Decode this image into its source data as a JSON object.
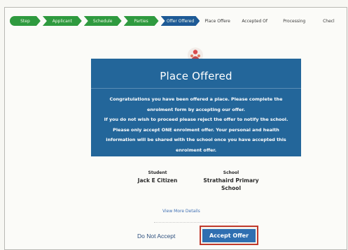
{
  "stepper": {
    "steps": [
      {
        "label": "Step"
      },
      {
        "label": "Applicant"
      },
      {
        "label": "Schedule"
      },
      {
        "label": "Parties"
      },
      {
        "label": "Offer Offered"
      },
      {
        "label": "Place Offere"
      },
      {
        "label": "Accepted Of"
      },
      {
        "label": "Processing"
      },
      {
        "label": "Checl"
      }
    ]
  },
  "panel": {
    "title": "Place Offered",
    "paragraph1": "Congratulations you have been offered a place. Please complete the enrolment form by accepting our offer.",
    "paragraph2": "If you do not wish to proceed please reject the offer to notify the school.",
    "paragraph3": "Please only accept ONE enrolment offer. Your personal and health information will be shared with the school once you have accepted this enrolment offer."
  },
  "details": {
    "student_label": "Student",
    "student_name": "Jack E Citizen",
    "school_label": "School",
    "school_name": "Strathaird Primary School"
  },
  "links": {
    "view_more": "View More Details"
  },
  "actions": {
    "decline_label": "Do Not Accept",
    "accept_label": "Accept Offer"
  },
  "colors": {
    "panel_blue": "#23669a",
    "step_done_green": "#2f9a3f",
    "step_current_blue": "#1e5a96",
    "accept_highlight_red": "#c0392b"
  }
}
